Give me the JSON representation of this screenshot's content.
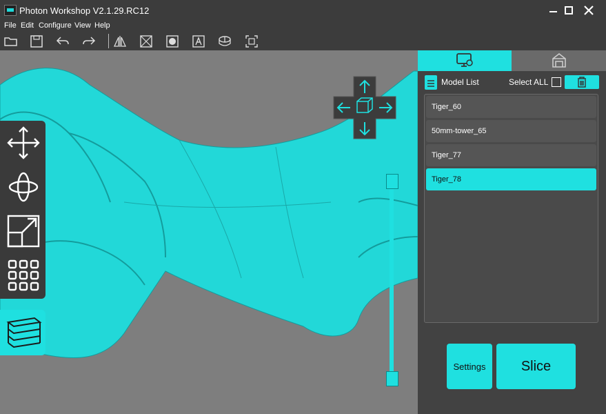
{
  "window": {
    "title": "Photon Workshop V2.1.29.RC12"
  },
  "menu": {
    "items": [
      "File",
      "Edit",
      "Configure",
      "View",
      "Help"
    ]
  },
  "toolbar": {
    "icons": [
      "open-folder",
      "save",
      "undo",
      "redo",
      "mirror",
      "hollow",
      "punch-hole",
      "text",
      "slice-preview",
      "auto-support"
    ]
  },
  "model_list": {
    "title": "Model List",
    "select_all_label": "Select ALL",
    "select_all_checked": false,
    "items": [
      "Tiger_60",
      "50mm-tower_65",
      "Tiger_77",
      "Tiger_78"
    ],
    "selected": "Tiger_78"
  },
  "actions": {
    "settings_label": "Settings",
    "slice_label": "Slice"
  },
  "colors": {
    "accent": "#1fe0e0",
    "panel": "#424242",
    "viewport": "#7e7e7e",
    "model": "#22d8d8"
  }
}
